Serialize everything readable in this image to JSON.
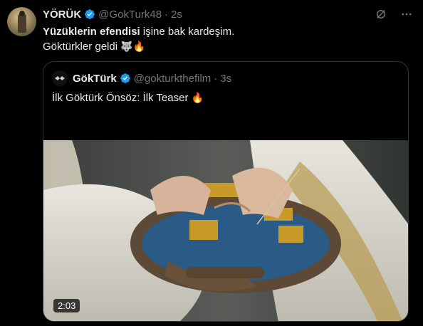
{
  "tweet": {
    "author_name": "YÖRÜK",
    "handle": "@GokTurk48",
    "dot": "·",
    "time": "2s",
    "text_bold": "Yüzüklerin efendisi",
    "text_rest": " işine bak kardeşim.",
    "text_line2": "Göktürkler geldi",
    "emoji_wolf": "🐺",
    "emoji_fire": "🔥"
  },
  "quote": {
    "author_name": "GökTürk",
    "handle": "@gokturkthefilm",
    "dot": "·",
    "time": "3s",
    "text": "İlk Göktürk Önsöz: İlk Teaser",
    "emoji_fire": "🔥",
    "video_duration": "2:03"
  },
  "colors": {
    "background": "#000000",
    "text": "#e7e9ea",
    "secondary": "#71767b",
    "verified": "#1d9bf0",
    "border": "#2f3336"
  },
  "icons": [
    "verified-badge-icon",
    "grok-icon",
    "more-icon"
  ]
}
